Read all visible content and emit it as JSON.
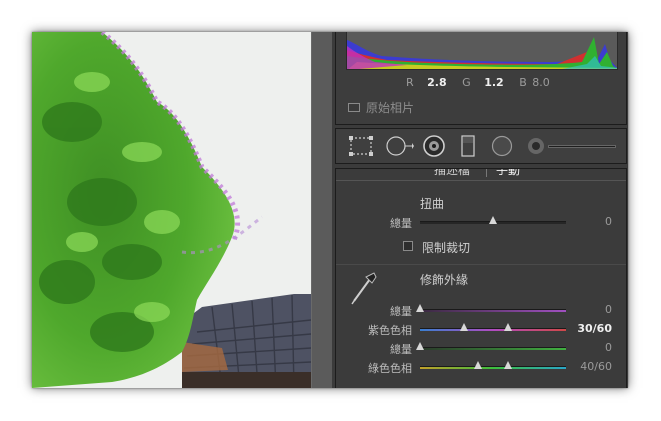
{
  "histogram": {
    "rgb_labels": [
      "R",
      "G",
      "B"
    ],
    "r_value": "2.8",
    "g_value": "1.2",
    "b_value": "8.0",
    "show_original_label": "原始相片"
  },
  "tools": {
    "icons": [
      "crop-overlay-icon",
      "spot-removal-icon",
      "red-eye-icon",
      "graduated-filter-icon",
      "radial-filter-icon",
      "adjustment-brush-icon"
    ]
  },
  "lens": {
    "tabs": [
      "描述檔",
      "手動"
    ],
    "distortion": {
      "title": "扭曲",
      "amount_label": "總量",
      "amount_value": "0",
      "amount_fraction": 0.5,
      "constrain_crop_label": "限制裁切"
    },
    "defringe": {
      "title": "修飾外緣",
      "purple_amount_label": "總量",
      "purple_amount_value": "0",
      "purple_amount_fraction": 0.0,
      "purple_hue_label": "紫色色相",
      "purple_hue_value": "30/60",
      "purple_hue_fractions": [
        0.3,
        0.6
      ],
      "green_amount_label": "總量",
      "green_amount_value": "0",
      "green_amount_fraction": 0.0,
      "green_hue_label": "綠色色相",
      "green_hue_value": "40/60",
      "green_hue_fractions": [
        0.4,
        0.6
      ]
    }
  },
  "colors": {
    "panel_bg": "#3b3b3b",
    "purple_track": [
      "#3a7fd0",
      "#b04cc0",
      "#d04848"
    ],
    "green_track": [
      "#c2a02a",
      "#3dbf3d",
      "#2aa6c8"
    ]
  }
}
